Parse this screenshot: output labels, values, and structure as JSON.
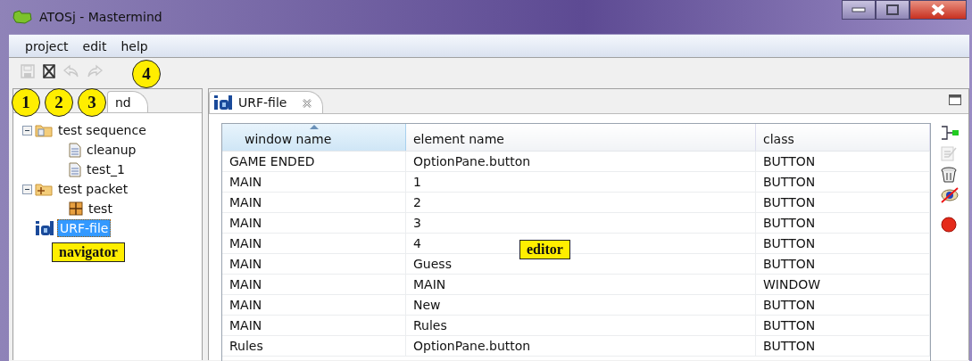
{
  "window": {
    "title": "ATOSj - Mastermind"
  },
  "menu": [
    {
      "label": "project"
    },
    {
      "label": "edit"
    },
    {
      "label": "help"
    }
  ],
  "toolbar": [
    {
      "kind": "save",
      "disabled": true
    },
    {
      "kind": "delete",
      "disabled": false
    },
    {
      "kind": "undo",
      "disabled": true
    },
    {
      "kind": "redo",
      "disabled": true
    }
  ],
  "navigator": {
    "tab": "nd",
    "tree": [
      {
        "label": "test sequence",
        "kind": "sequence",
        "expanded": true,
        "selected": false,
        "children": [
          {
            "label": "cleanup",
            "kind": "document",
            "selected": false
          },
          {
            "label": "test_1",
            "kind": "document",
            "selected": false
          }
        ]
      },
      {
        "label": "test packet",
        "kind": "packet",
        "expanded": true,
        "selected": false,
        "children": [
          {
            "label": "test",
            "kind": "test",
            "selected": false
          }
        ]
      },
      {
        "label": "URF-file",
        "kind": "urf",
        "selected": true
      }
    ]
  },
  "editor": {
    "tab": "URF-file",
    "columns": [
      {
        "label": "window name",
        "sorted": true
      },
      {
        "label": "element name",
        "sorted": false
      },
      {
        "label": "class",
        "sorted": false
      }
    ],
    "rows": [
      [
        "GAME ENDED",
        "OptionPane.button",
        "BUTTON"
      ],
      [
        "MAIN",
        "1",
        "BUTTON"
      ],
      [
        "MAIN",
        "2",
        "BUTTON"
      ],
      [
        "MAIN",
        "3",
        "BUTTON"
      ],
      [
        "MAIN",
        "4",
        "BUTTON"
      ],
      [
        "MAIN",
        "Guess",
        "BUTTON"
      ],
      [
        "MAIN",
        "MAIN",
        "WINDOW"
      ],
      [
        "MAIN",
        "New",
        "BUTTON"
      ],
      [
        "MAIN",
        "Rules",
        "BUTTON"
      ],
      [
        "Rules",
        "OptionPane.button",
        "BUTTON"
      ]
    ],
    "side_tools": [
      {
        "kind": "add",
        "disabled": false
      },
      {
        "kind": "edit",
        "disabled": true
      },
      {
        "kind": "delete",
        "disabled": false
      },
      {
        "kind": "hide",
        "disabled": false
      },
      {
        "kind": "record",
        "disabled": false
      }
    ]
  },
  "callouts": [
    {
      "kind": "circle",
      "label": "1"
    },
    {
      "kind": "circle",
      "label": "2"
    },
    {
      "kind": "circle",
      "label": "3"
    },
    {
      "kind": "circle",
      "label": "4"
    },
    {
      "kind": "box",
      "label": "navigator"
    },
    {
      "kind": "box",
      "label": "editor"
    }
  ]
}
